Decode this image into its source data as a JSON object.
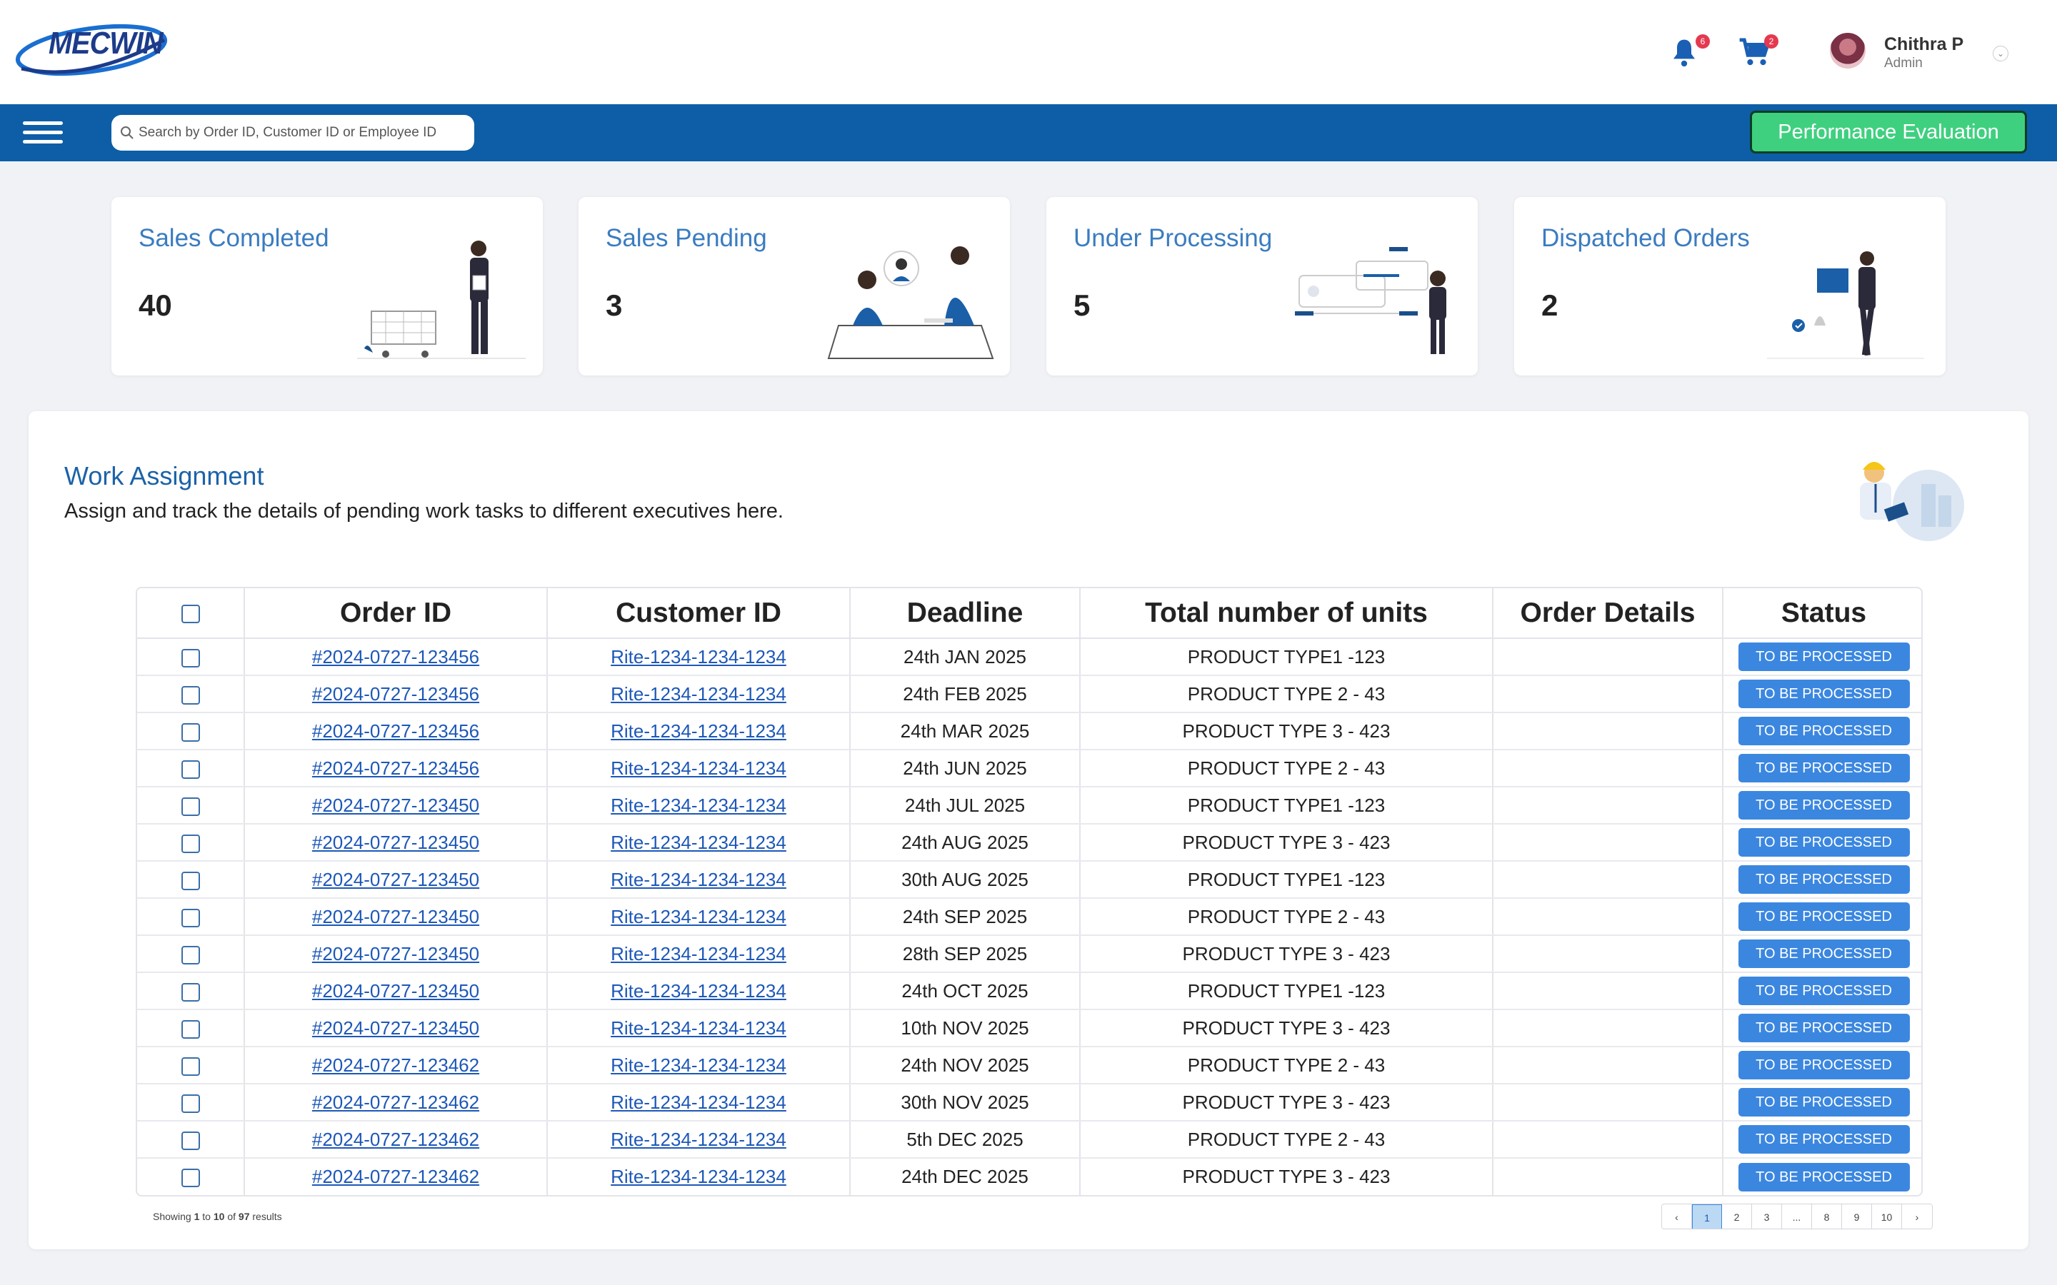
{
  "header": {
    "logo_text": "MECWIN",
    "notifications_count": "6",
    "cart_count": "2",
    "user_name": "Chithra P",
    "user_role": "Admin"
  },
  "navbar": {
    "search_placeholder": "Search by Order ID, Customer ID or Employee ID",
    "performance_button": "Performance Evaluation"
  },
  "cards": [
    {
      "title": "Sales Completed",
      "value": "40"
    },
    {
      "title": "Sales Pending",
      "value": "3"
    },
    {
      "title": "Under Processing",
      "value": "5"
    },
    {
      "title": "Dispatched Orders",
      "value": "2"
    }
  ],
  "work_assignment": {
    "title": "Work Assignment",
    "subtitle": "Assign and track the details of pending work tasks to different executives here."
  },
  "table": {
    "columns": [
      "Order ID",
      "Customer ID",
      "Deadline",
      "Total number of units",
      "Order Details",
      "Status"
    ],
    "rows": [
      {
        "order_id": "#2024-0727-123456",
        "customer_id": "Rite-1234-1234-1234",
        "deadline": "24th JAN 2025",
        "units": "PRODUCT TYPE1 -123",
        "details": "",
        "status": "TO BE PROCESSED"
      },
      {
        "order_id": "#2024-0727-123456",
        "customer_id": "Rite-1234-1234-1234",
        "deadline": "24th FEB 2025",
        "units": "PRODUCT TYPE 2 - 43",
        "details": "",
        "status": "TO BE PROCESSED"
      },
      {
        "order_id": "#2024-0727-123456",
        "customer_id": "Rite-1234-1234-1234",
        "deadline": "24th MAR 2025",
        "units": "PRODUCT TYPE 3 - 423",
        "details": "",
        "status": "TO BE PROCESSED"
      },
      {
        "order_id": "#2024-0727-123456",
        "customer_id": "Rite-1234-1234-1234",
        "deadline": "24th JUN 2025",
        "units": "PRODUCT TYPE 2 - 43",
        "details": "",
        "status": "TO BE PROCESSED"
      },
      {
        "order_id": "#2024-0727-123450",
        "customer_id": "Rite-1234-1234-1234",
        "deadline": "24th JUL 2025",
        "units": "PRODUCT TYPE1 -123",
        "details": "",
        "status": "TO BE PROCESSED"
      },
      {
        "order_id": "#2024-0727-123450",
        "customer_id": "Rite-1234-1234-1234",
        "deadline": "24th AUG 2025",
        "units": "PRODUCT TYPE 3 - 423",
        "details": "",
        "status": "TO BE PROCESSED"
      },
      {
        "order_id": "#2024-0727-123450",
        "customer_id": "Rite-1234-1234-1234",
        "deadline": "30th AUG 2025",
        "units": "PRODUCT TYPE1 -123",
        "details": "",
        "status": "TO BE PROCESSED"
      },
      {
        "order_id": "#2024-0727-123450",
        "customer_id": "Rite-1234-1234-1234",
        "deadline": "24th SEP 2025",
        "units": "PRODUCT TYPE 2 - 43",
        "details": "",
        "status": "TO BE PROCESSED"
      },
      {
        "order_id": "#2024-0727-123450",
        "customer_id": "Rite-1234-1234-1234",
        "deadline": "28th SEP 2025",
        "units": "PRODUCT TYPE 3 - 423",
        "details": "",
        "status": "TO BE PROCESSED"
      },
      {
        "order_id": "#2024-0727-123450",
        "customer_id": "Rite-1234-1234-1234",
        "deadline": "24th OCT 2025",
        "units": "PRODUCT TYPE1 -123",
        "details": "",
        "status": "TO BE PROCESSED"
      },
      {
        "order_id": "#2024-0727-123450",
        "customer_id": "Rite-1234-1234-1234",
        "deadline": "10th NOV 2025",
        "units": "PRODUCT TYPE 3 - 423",
        "details": "",
        "status": "TO BE PROCESSED"
      },
      {
        "order_id": "#2024-0727-123462",
        "customer_id": "Rite-1234-1234-1234",
        "deadline": "24th NOV 2025",
        "units": "PRODUCT TYPE 2 - 43",
        "details": "",
        "status": "TO BE PROCESSED"
      },
      {
        "order_id": "#2024-0727-123462",
        "customer_id": "Rite-1234-1234-1234",
        "deadline": "30th NOV 2025",
        "units": "PRODUCT TYPE 3 - 423",
        "details": "",
        "status": "TO BE PROCESSED"
      },
      {
        "order_id": "#2024-0727-123462",
        "customer_id": "Rite-1234-1234-1234",
        "deadline": "5th DEC 2025",
        "units": "PRODUCT TYPE 2 - 43",
        "details": "",
        "status": "TO BE PROCESSED"
      },
      {
        "order_id": "#2024-0727-123462",
        "customer_id": "Rite-1234-1234-1234",
        "deadline": "24th DEC 2025",
        "units": "PRODUCT TYPE 3 - 423",
        "details": "",
        "status": "TO BE PROCESSED"
      }
    ]
  },
  "footer": {
    "showing_prefix": "Showing",
    "showing_from": "1",
    "showing_to_word": "to",
    "showing_to": "10",
    "showing_of_word": "of",
    "showing_total": "97",
    "showing_suffix": "results",
    "pages": [
      "1",
      "2",
      "3",
      "...",
      "8",
      "9",
      "10"
    ],
    "active_page": "1",
    "prev_icon": "chevron-left-icon",
    "next_icon": "chevron-right-icon"
  },
  "colors": {
    "navbar": "#0d5ea6",
    "accent_green": "#3fd07f",
    "status_button": "#3b87e0",
    "card_title": "#3a7cc0"
  }
}
